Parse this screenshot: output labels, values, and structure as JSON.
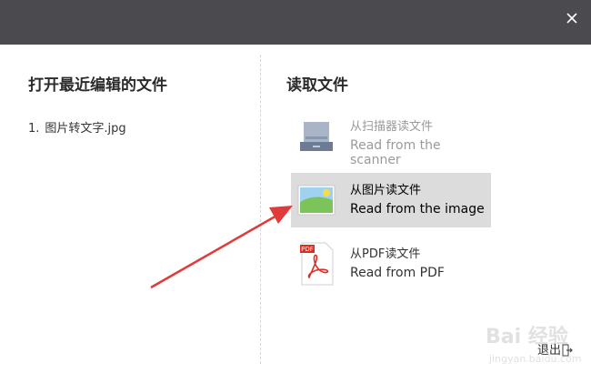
{
  "left": {
    "heading": "打开最近编辑的文件",
    "recent_files": [
      {
        "index": "1.",
        "name": "图片转文字.jpg"
      }
    ]
  },
  "right": {
    "heading": "读取文件",
    "options": [
      {
        "cn": "从扫描器读文件",
        "en": "Read from the scanner",
        "icon": "scanner-icon",
        "state": "disabled"
      },
      {
        "cn": "从图片读文件",
        "en": "Read from the image",
        "icon": "image-icon",
        "state": "selected"
      },
      {
        "cn": "从PDF读文件",
        "en": "Read from PDF",
        "icon": "pdf-icon",
        "state": "normal"
      }
    ]
  },
  "footer": {
    "exit_label": "退出"
  },
  "watermark": {
    "line1": "Bai 经验",
    "line2": "jingyan.baidu.com"
  },
  "pdf_badge": "PDF",
  "colors": {
    "titlebar": "#4a4a4f",
    "selected_bg": "#dcdcdc",
    "arrow": "#e03a3a"
  }
}
